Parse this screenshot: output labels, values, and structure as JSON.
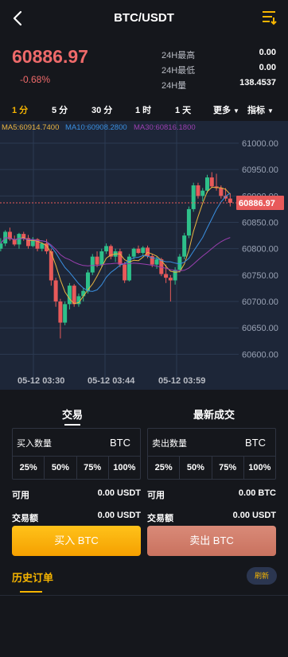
{
  "header": {
    "title": "BTC/USDT",
    "back_icon": "chevron-left-icon",
    "menu_icon": "list-filter-icon"
  },
  "ticker": {
    "last_price": "60886.97",
    "change": "-0.68%",
    "stats": [
      {
        "label": "24H最高",
        "value": "0.00"
      },
      {
        "label": "24H最低",
        "value": "0.00"
      },
      {
        "label": "24H量",
        "value": "138.4537"
      }
    ]
  },
  "periods": {
    "items": [
      "1 分",
      "5 分",
      "30 分",
      "1 时",
      "1 天"
    ],
    "active_index": 0,
    "more_label": "更多",
    "indicator_label": "指标"
  },
  "chart_data": {
    "type": "candlestick",
    "ma_labels": [
      "MA5:60914.7400",
      "MA10:60908.2800",
      "MA30:60816.1800"
    ],
    "ma_colors": [
      "#e8b341",
      "#3a8fe0",
      "#9b3fb0"
    ],
    "y_ticks": [
      "61000.00",
      "60950.00",
      "60900.00",
      "60850.00",
      "60800.00",
      "60750.00",
      "60700.00",
      "60650.00",
      "60600.00"
    ],
    "ylim": [
      60575,
      61015
    ],
    "x_ticks": [
      "05-12 03:30",
      "05-12 03:44",
      "05-12 03:59"
    ],
    "current_price": "60886.97",
    "up_color": "#2ec08a",
    "down_color": "#e85a5a",
    "candles": [
      [
        60800,
        60820,
        60795,
        60810
      ],
      [
        60810,
        60835,
        60805,
        60832
      ],
      [
        60832,
        60840,
        60815,
        60818
      ],
      [
        60818,
        60825,
        60805,
        60808
      ],
      [
        60808,
        60830,
        60800,
        60828
      ],
      [
        60828,
        60832,
        60815,
        60820
      ],
      [
        60820,
        60826,
        60800,
        60805
      ],
      [
        60805,
        60822,
        60803,
        60818
      ],
      [
        60818,
        60820,
        60795,
        60800
      ],
      [
        60800,
        60812,
        60795,
        60810
      ],
      [
        60810,
        60818,
        60790,
        60795
      ],
      [
        60795,
        60800,
        60730,
        60740
      ],
      [
        60740,
        60745,
        60690,
        60700
      ],
      [
        60700,
        60705,
        60630,
        60660
      ],
      [
        60660,
        60700,
        60655,
        60695
      ],
      [
        60695,
        60735,
        60685,
        60730
      ],
      [
        60730,
        60733,
        60690,
        60695
      ],
      [
        60695,
        60715,
        60690,
        60710
      ],
      [
        60710,
        60725,
        60700,
        60720
      ],
      [
        60720,
        60760,
        60715,
        60755
      ],
      [
        60755,
        60790,
        60750,
        60785
      ],
      [
        60785,
        60795,
        60765,
        60770
      ],
      [
        60770,
        60800,
        60765,
        60795
      ],
      [
        60795,
        60810,
        60790,
        60805
      ],
      [
        60805,
        60808,
        60780,
        60785
      ],
      [
        60785,
        60800,
        60775,
        60795
      ],
      [
        60795,
        60800,
        60765,
        60770
      ],
      [
        60770,
        60775,
        60735,
        60740
      ],
      [
        60740,
        60790,
        60738,
        60785
      ],
      [
        60785,
        60802,
        60780,
        60800
      ],
      [
        60800,
        60806,
        60790,
        60792
      ],
      [
        60792,
        60805,
        60788,
        60802
      ],
      [
        60802,
        60806,
        60782,
        60786
      ],
      [
        60786,
        60790,
        60765,
        60770
      ],
      [
        60770,
        60785,
        60762,
        60780
      ],
      [
        60780,
        60783,
        60748,
        60752
      ],
      [
        60752,
        60770,
        60735,
        60745
      ],
      [
        60745,
        60750,
        60700,
        60740
      ],
      [
        60740,
        60765,
        60732,
        60760
      ],
      [
        60760,
        60790,
        60755,
        60785
      ],
      [
        60785,
        60830,
        60780,
        60825
      ],
      [
        60825,
        60880,
        60820,
        60875
      ],
      [
        60875,
        60925,
        60870,
        60920
      ],
      [
        60920,
        60925,
        60895,
        60900
      ],
      [
        60900,
        60915,
        60890,
        60910
      ],
      [
        60910,
        60940,
        60905,
        60935
      ],
      [
        60935,
        60945,
        60915,
        60918
      ],
      [
        60918,
        60942,
        60910,
        60915
      ],
      [
        60915,
        60920,
        60895,
        60900
      ],
      [
        60900,
        60915,
        60890,
        60895
      ],
      [
        60895,
        60905,
        60880,
        60887
      ]
    ]
  },
  "trade": {
    "tabs": [
      "交易",
      "最新成交"
    ],
    "buy_box": {
      "label": "买入数量",
      "asset": "BTC"
    },
    "sell_box": {
      "label": "卖出数量",
      "asset": "BTC"
    },
    "percentages": [
      "25%",
      "50%",
      "75%",
      "100%"
    ],
    "buy_available_label": "可用",
    "buy_available_value": "0.00 USDT",
    "sell_available_label": "可用",
    "sell_available_value": "0.00 BTC",
    "buy_amount_label": "交易额",
    "buy_amount_value": "0.00 USDT",
    "sell_amount_label": "交易额",
    "sell_amount_value": "0.00 USDT",
    "buy_button": "买入 BTC",
    "sell_button": "卖出 BTC"
  },
  "history": {
    "title": "历史订单",
    "refresh_label": "刷新"
  }
}
